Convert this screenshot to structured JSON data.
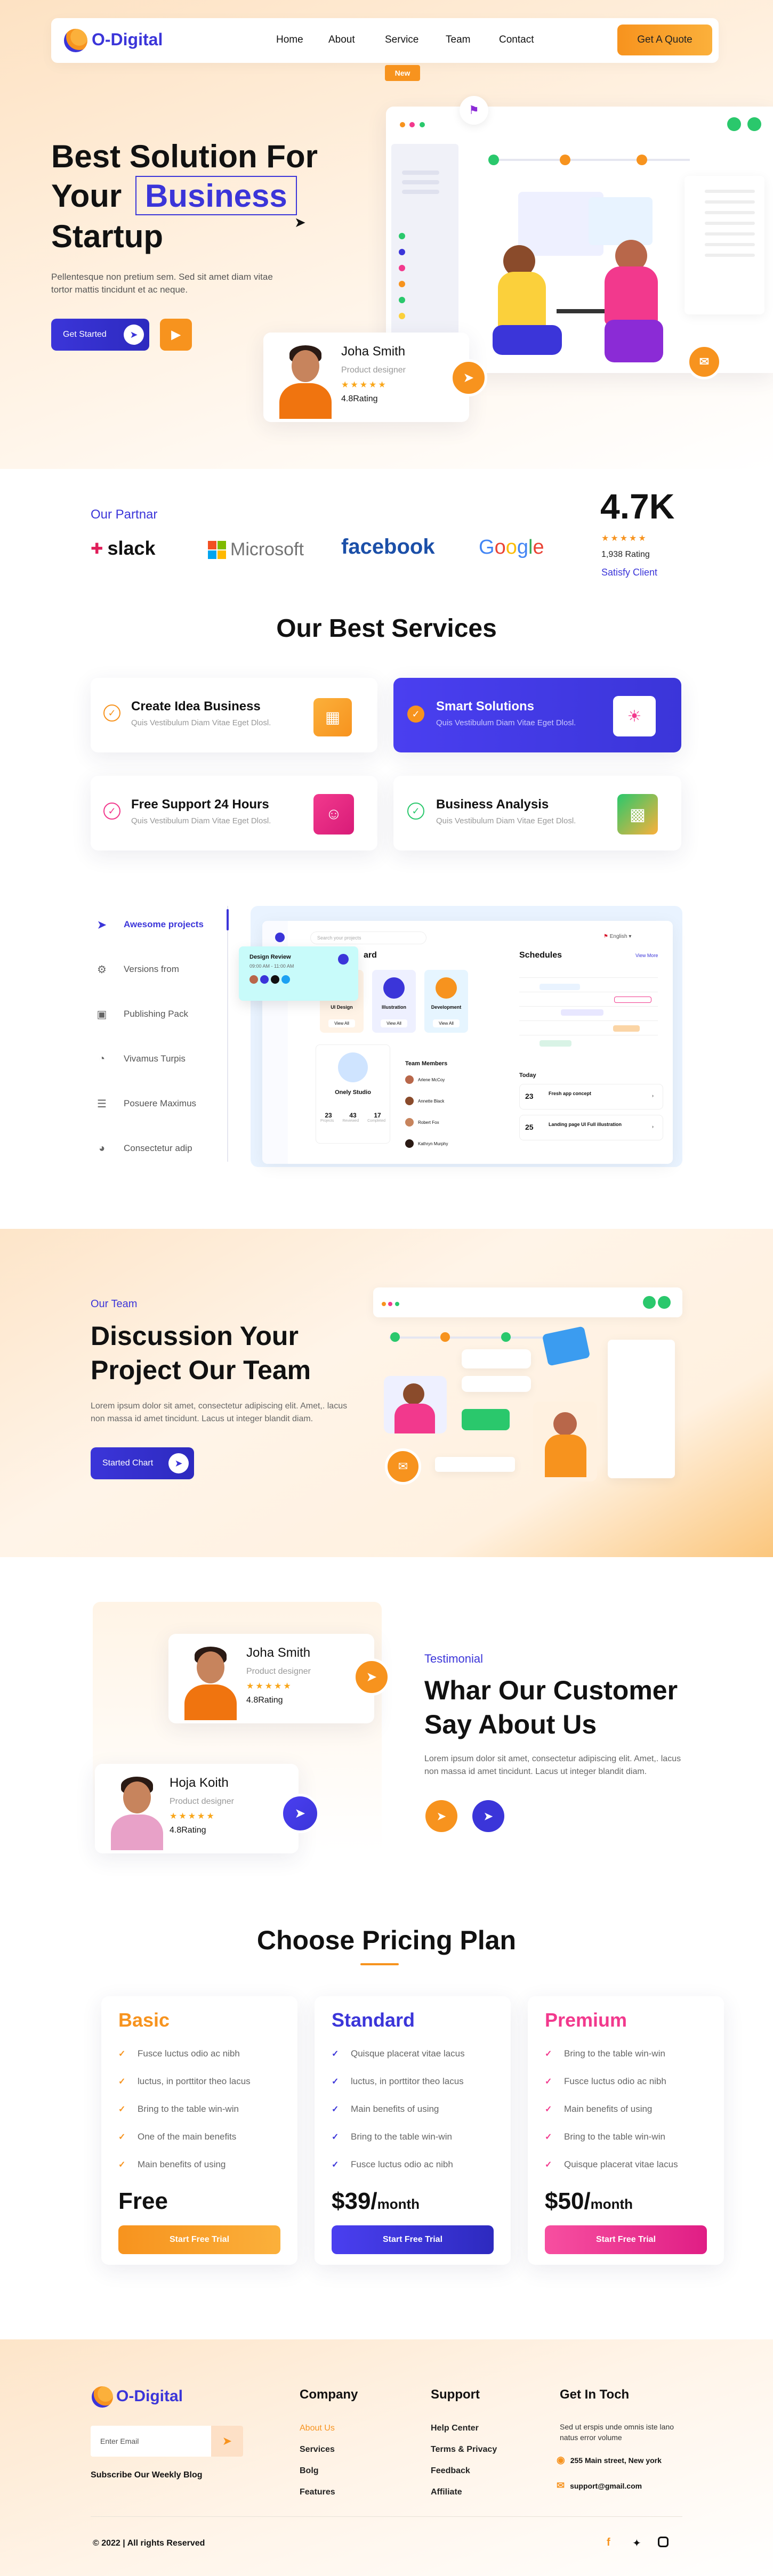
{
  "nav": {
    "brand": "O-Digital",
    "links": [
      "Home",
      "About",
      "Service",
      "Team",
      "Contact"
    ],
    "active_badge": "New",
    "cta": "Get A Quote"
  },
  "hero": {
    "line1": "Best Solution For",
    "line2_prefix": "Your",
    "highlight": "Business",
    "line3": "Startup",
    "desc_1": "Pellentesque non pretium sem. Sed sit amet diam vitae",
    "desc_2": "tortor mattis tincidunt et ac neque.",
    "start_btn": "Get Started",
    "profile": {
      "name": "Joha Smith",
      "role": "Product designer",
      "rating": "4.8Rating"
    }
  },
  "partners": {
    "label": "Our Partnar",
    "logos": [
      "slack",
      "Microsoft",
      "facebook",
      "Google"
    ],
    "stat": "4.7K",
    "rating_count": "1,938 Rating",
    "satisfy": "Satisfy Client"
  },
  "services": {
    "title": "Our Best Services",
    "items": [
      {
        "title": "Create Idea Business",
        "sub": "Quis Vestibulum Diam Vitae Eget Dlosl."
      },
      {
        "title": "Smart Solutions",
        "sub": "Quis Vestibulum Diam Vitae Eget Dlosl."
      },
      {
        "title": "Free Support 24 Hours",
        "sub": "Quis Vestibulum Diam Vitae Eget Dlosl."
      },
      {
        "title": "Business Analysis",
        "sub": "Quis Vestibulum Diam Vitae Eget Dlosl."
      }
    ]
  },
  "dashboard": {
    "menu": [
      "Awesome projects",
      "Versions from",
      "Publishing Pack",
      "Vivamus Turpis",
      "Posuere Maximus",
      "Consectetur adip"
    ],
    "search_placeholder": "Search your projects",
    "lang": "English",
    "heading": "ard",
    "schedules": "Schedules",
    "view_more": "View More",
    "popup_title": "Design Review",
    "popup_time": "09:00 AM - 11:00 AM",
    "tiles": [
      "UI Design",
      "Illustration",
      "Development"
    ],
    "tile_btn": "View All",
    "studio": "Onely Studio",
    "studio_stats": [
      "23",
      "43",
      "17"
    ],
    "studio_labels": [
      "Projects",
      "Reviewed",
      "Completed"
    ],
    "team_members": "Team Members",
    "members": [
      "Arlene McCoy",
      "Annette Black",
      "Robert Fox",
      "Kathryn Murphy"
    ],
    "today": "Today",
    "tasks": [
      {
        "day": "23",
        "title": "Fresh app concept"
      },
      {
        "day": "25",
        "title": "Landing page UI Full illustration"
      }
    ]
  },
  "team": {
    "label": "Our Team",
    "title_1": "Discussion Your",
    "title_2": "Project Our Team",
    "desc_1": "Lorem ipsum dolor sit amet, consectetur adipiscing elit. Amet,. lacus",
    "desc_2": "non massa id amet tincidunt. Lacus ut integer blandit diam.",
    "btn": "Started Chart"
  },
  "testimonial": {
    "label": "Testimonial",
    "title_1": "Whar Our Customer",
    "title_2": "Say About Us",
    "desc_1": "Lorem ipsum dolor sit amet, consectetur adipiscing elit. Amet,. lacus",
    "desc_2": "non massa id amet tincidunt. Lacus ut integer blandit diam.",
    "cards": [
      {
        "name": "Joha Smith",
        "role": "Product designer",
        "rating": "4.8Rating"
      },
      {
        "name": "Hoja Koith",
        "role": "Product designer",
        "rating": "4.8Rating"
      }
    ]
  },
  "pricing": {
    "title": "Choose Pricing Plan",
    "plans": [
      {
        "name": "Basic",
        "color": "#f7931e",
        "features": [
          "Fusce luctus odio ac nibh",
          "luctus, in porttitor theo lacus",
          "Bring to the table win-win",
          "One of the main benefits",
          "Main benefits of using"
        ],
        "price": "Free",
        "period": "",
        "cta": "Start Free Trial"
      },
      {
        "name": "Standard",
        "color": "#3b35d9",
        "features": [
          "Quisque placerat vitae lacus",
          "luctus, in porttitor theo lacus",
          "Main benefits of using",
          "Bring to the table win-win",
          "Fusce luctus odio ac nibh"
        ],
        "price": "$39/",
        "period": "month",
        "cta": "Start Free Trial"
      },
      {
        "name": "Premium",
        "color": "#f2398d",
        "features": [
          "Bring to the table win-win",
          "Fusce luctus odio ac nibh",
          "Main benefits of using",
          "Bring to the table win-win",
          "Quisque placerat vitae lacus"
        ],
        "price": "$50/",
        "period": "month",
        "cta": "Start Free Trial"
      }
    ]
  },
  "footer": {
    "brand": "O-Digital",
    "email_placeholder": "Enter Email",
    "subscribe": "Subscribe Our Weekly Blog",
    "company_title": "Company",
    "company_links": [
      "About Us",
      "Services",
      "Bolg",
      "Features"
    ],
    "support_title": "Support",
    "support_links": [
      "Help Center",
      "Terms & Privacy",
      "Feedback",
      "Affiliate"
    ],
    "touch_title": "Get In Toch",
    "touch_desc_1": "Sed ut erspis unde omnis iste  lano",
    "touch_desc_2": "natus error volume",
    "address": "255 Main street, New york",
    "email": "support@gmail.com",
    "copyright": "© 2022 | All rights Reserved"
  },
  "colors": {
    "accent": "#f7931e",
    "brand": "#3b35d9",
    "pink": "#f2398d"
  }
}
